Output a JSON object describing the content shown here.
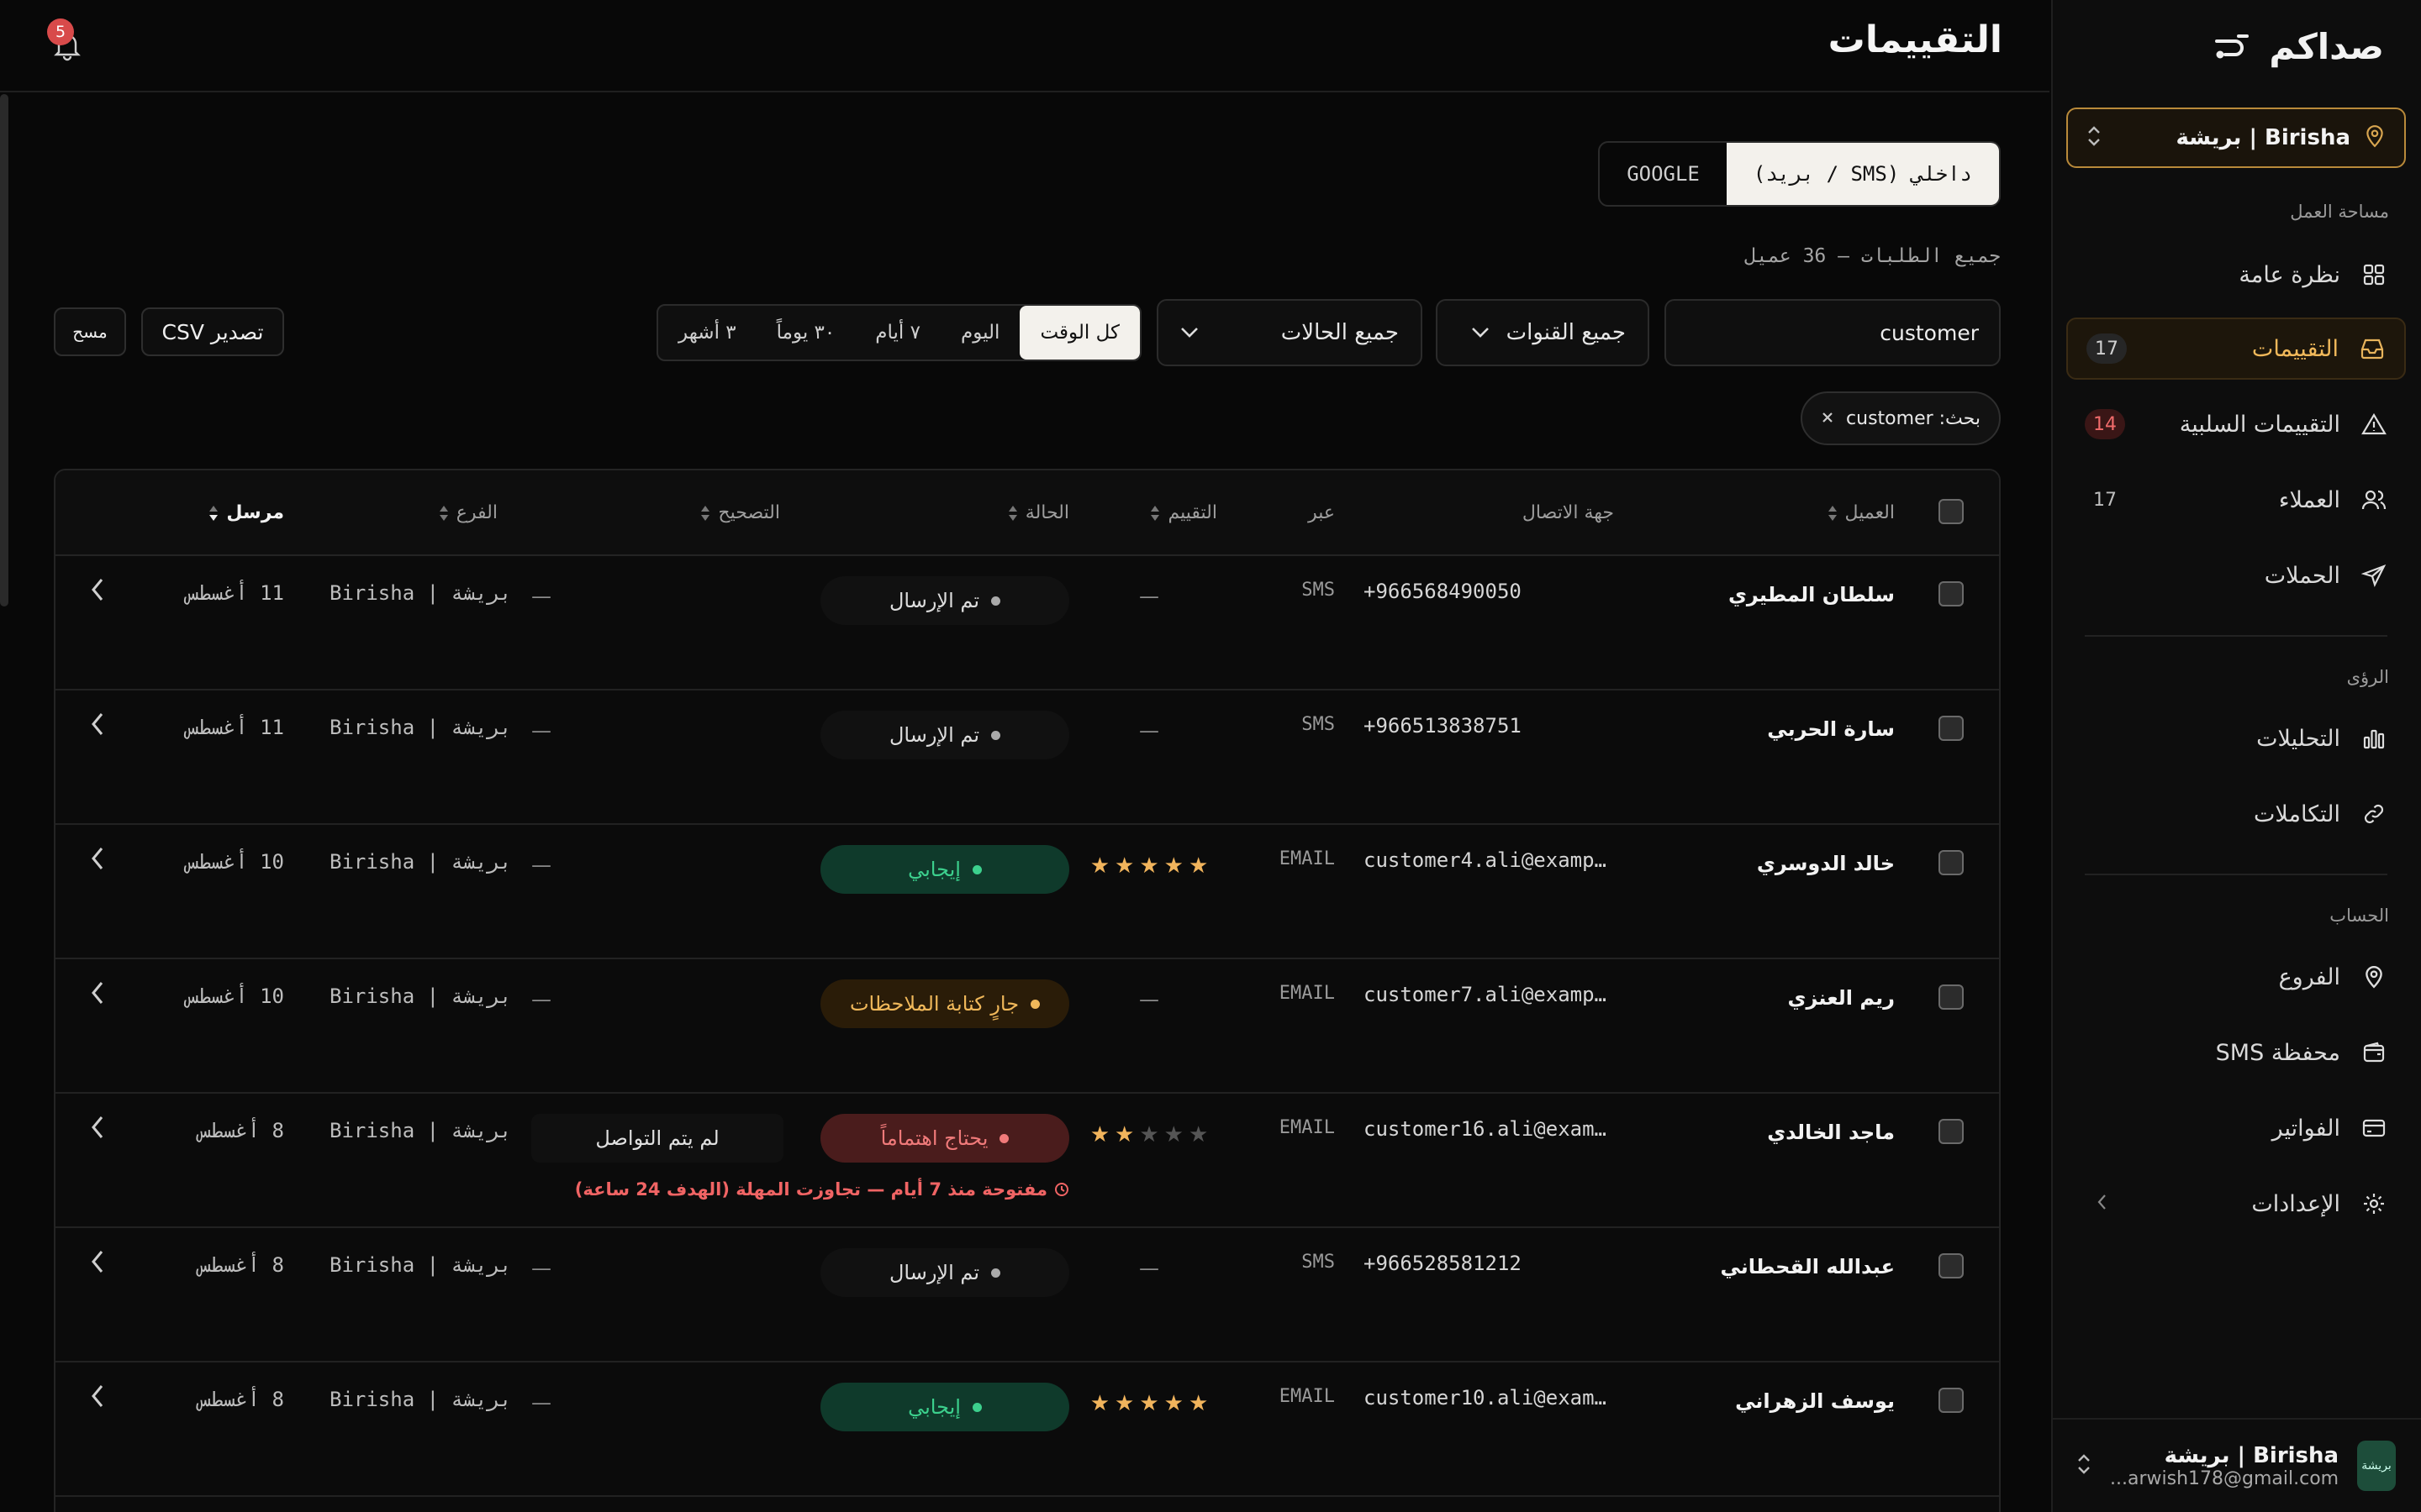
{
  "brand": {
    "name": "صداكم"
  },
  "branch_select": {
    "label": "Birisha | بريشة"
  },
  "sidebar": {
    "section_workspace": "مساحة العمل",
    "section_insights": "الرؤى",
    "section_account": "الحساب",
    "items": [
      {
        "label": "نظرة عامة",
        "icon": "grid-icon"
      },
      {
        "label": "التقييمات",
        "icon": "inbox-icon",
        "count": "17",
        "active": true
      },
      {
        "label": "التقييمات السلبية",
        "icon": "warning-icon",
        "count": "14"
      },
      {
        "label": "العملاء",
        "icon": "users-icon",
        "count": "17"
      },
      {
        "label": "الحملات",
        "icon": "send-icon"
      },
      {
        "label": "التحليلات",
        "icon": "bar-chart-icon"
      },
      {
        "label": "التكاملات",
        "icon": "link-icon"
      },
      {
        "label": "الفروع",
        "icon": "map-pin-icon"
      },
      {
        "label": "محفظة SMS",
        "icon": "wallet-icon"
      },
      {
        "label": "الفواتير",
        "icon": "credit-card-icon"
      },
      {
        "label": "الإعدادات",
        "icon": "gear-icon"
      }
    ]
  },
  "user": {
    "name": "Birisha | بريشة",
    "email": "...arwish178@gmail.com",
    "avatar_text": "بريشة"
  },
  "header": {
    "title": "التقييمات",
    "notifications": "5"
  },
  "source_tabs": [
    "داخلي (SMS / بريد)",
    "GOOGLE"
  ],
  "request_count": "جميع الطلبات — 36 عميل",
  "filters": {
    "search_value": "customer",
    "channels": "جميع القنوات",
    "statuses": "جميع الحالات",
    "ranges": [
      "كل الوقت",
      "اليوم",
      "٧ أيام",
      "٣٠ يوماً",
      "٣ أشهر"
    ],
    "export": "تصدير CSV",
    "clear": "مسح"
  },
  "chip": {
    "label": "بحث: customer"
  },
  "table": {
    "headers": {
      "customer": "العميل",
      "contact": "جهة الاتصال",
      "via": "عبر",
      "rating": "التقييم",
      "status": "الحالة",
      "correction": "التصحيح",
      "branch": "الفرع",
      "sent": "مرسل"
    },
    "rows": [
      {
        "name": "سلطان المطيري",
        "contact": "+966568490050",
        "via": "SMS",
        "rating": "—",
        "status": "تم الإرسال",
        "status_kind": "sent",
        "correction": "—",
        "branch": "Birisha | بريشة",
        "sent": "11 أغسطس"
      },
      {
        "name": "سارة الحربي",
        "contact": "+966513838751",
        "via": "SMS",
        "rating": "—",
        "status": "تم الإرسال",
        "status_kind": "sent",
        "correction": "—",
        "branch": "Birisha | بريشة",
        "sent": "11 أغسطس"
      },
      {
        "name": "خالد الدوسري",
        "contact": "customer4.ali@examp…",
        "via": "EMAIL",
        "stars": 5,
        "status": "إيجابي",
        "status_kind": "pos",
        "correction": "—",
        "branch": "Birisha | بريشة",
        "sent": "10 أغسطس"
      },
      {
        "name": "ريم العنزي",
        "contact": "customer7.ali@examp…",
        "via": "EMAIL",
        "rating": "—",
        "status": "جارٍ كتابة الملاحظات",
        "status_kind": "writing",
        "correction": "—",
        "branch": "Birisha | بريشة",
        "sent": "10 أغسطس"
      },
      {
        "name": "ماجد الخالدي",
        "contact": "customer16.ali@exam…",
        "via": "EMAIL",
        "stars": 2,
        "status": "يحتاج اهتماماً",
        "status_kind": "attn",
        "correction": "لم يتم التواصل",
        "overdue": "مفتوحة منذ 7 أيام — تجاوزت المهلة (الهدف 24 ساعة)",
        "branch": "Birisha | بريشة",
        "sent": "8 أغسطس"
      },
      {
        "name": "عبدالله القحطاني",
        "contact": "+966528581212",
        "via": "SMS",
        "rating": "—",
        "status": "تم الإرسال",
        "status_kind": "sent",
        "correction": "—",
        "branch": "Birisha | بريشة",
        "sent": "8 أغسطس"
      },
      {
        "name": "يوسف الزهراني",
        "contact": "customer10.ali@exam…",
        "via": "EMAIL",
        "stars": 5,
        "status": "إيجابي",
        "status_kind": "pos",
        "correction": "—",
        "branch": "Birisha | بريشة",
        "sent": "8 أغسطس"
      }
    ]
  },
  "colors": {
    "accent": "#f0b85a",
    "positive": "#3cd08d",
    "negative": "#f07a7a",
    "background": "#080808"
  }
}
